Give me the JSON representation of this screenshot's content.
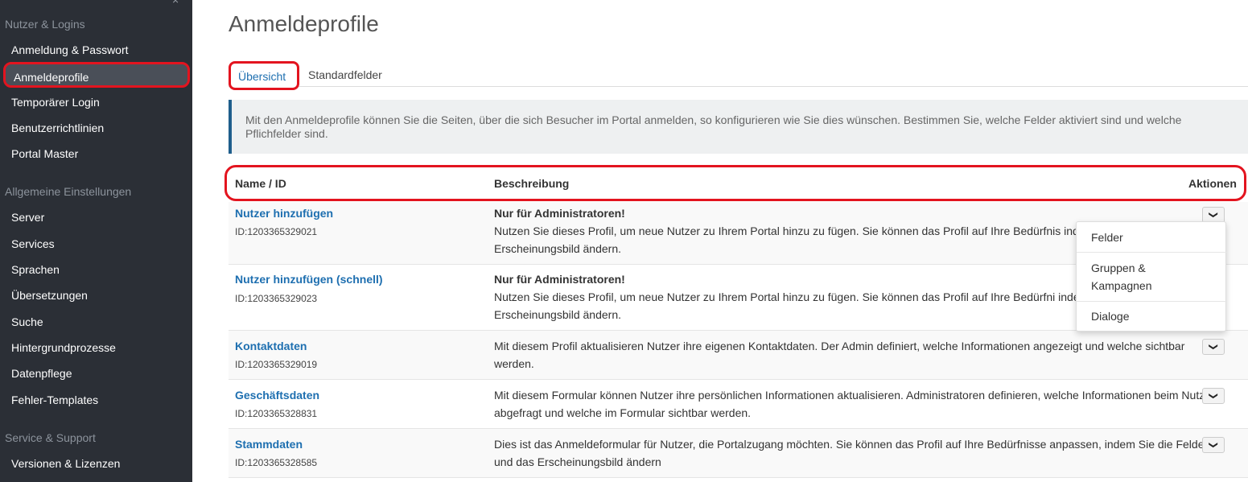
{
  "sidebar": {
    "close": "×",
    "sections": [
      {
        "title": "Nutzer & Logins",
        "items": [
          "Anmeldung & Passwort",
          "Anmeldeprofile",
          "Temporärer Login",
          "Benutzerrichtlinien",
          "Portal Master"
        ]
      },
      {
        "title": "Allgemeine Einstellungen",
        "items": [
          "Server",
          "Services",
          "Sprachen",
          "Übersetzungen",
          "Suche",
          "Hintergrundprozesse",
          "Datenpflege",
          "Fehler-Templates"
        ]
      },
      {
        "title": "Service & Support",
        "items": [
          "Versionen & Lizenzen"
        ]
      }
    ],
    "active_item": "Anmeldeprofile"
  },
  "main": {
    "title": "Anmeldeprofile",
    "tabs": [
      "Übersicht",
      "Standardfelder"
    ],
    "active_tab": "Übersicht",
    "info": "Mit den Anmeldeprofile können Sie die Seiten, über die sich Besucher im Portal anmelden, so konfigurieren wie Sie dies wünschen. Bestimmen Sie, welche Felder aktiviert sind und welche Pflichfelder sind."
  },
  "table": {
    "headers": {
      "name": "Name / ID",
      "desc": "Beschreibung",
      "actions": "Aktionen"
    },
    "rows": [
      {
        "name": "Nutzer hinzufügen",
        "id": "ID:1203365329021",
        "desc_bold": "Nur für Administratoren!",
        "desc": "Nutzen Sie dieses Profil, um neue Nutzer zu Ihrem Portal hinzu zu fügen. Sie können das Profil auf Ihre Bedürfnis indem Sie die Felder und das Erscheinungsbild ändern."
      },
      {
        "name": "Nutzer hinzufügen (schnell)",
        "id": "ID:1203365329023",
        "desc_bold": "Nur für Administratoren!",
        "desc": "Nutzen Sie dieses Profil, um neue Nutzer zu Ihrem Portal hinzu zu fügen. Sie können das Profil auf Ihre Bedürfni indem Sie die Felder und das Erscheinungsbild ändern."
      },
      {
        "name": "Kontaktdaten",
        "id": "ID:1203365329019",
        "desc_bold": "",
        "desc": "Mit diesem Profil aktualisieren Nutzer ihre eigenen Kontaktdaten. Der Admin definiert, welche Informationen angezeigt und welche sichtbar werden."
      },
      {
        "name": "Geschäftsdaten",
        "id": "ID:1203365328831",
        "desc_bold": "",
        "desc": "Mit diesem Formular können Nutzer ihre persönlichen Informationen aktualisieren. Administratoren definieren, welche Informationen beim Nutzer abgefragt und welche im Formular sichtbar werden."
      },
      {
        "name": "Stammdaten",
        "id": "ID:1203365328585",
        "desc_bold": "",
        "desc": "Dies ist das Anmeldeformular für Nutzer, die Portalzugang möchten. Sie können das Profil auf Ihre Bedürfnisse anpassen, indem Sie die Felder und das Erscheinungsbild ändern"
      }
    ],
    "action_icon": "chevron-down-icon"
  },
  "dropdown": {
    "items": [
      "Felder",
      "Gruppen & Kampagnen",
      "Dialoge"
    ]
  }
}
